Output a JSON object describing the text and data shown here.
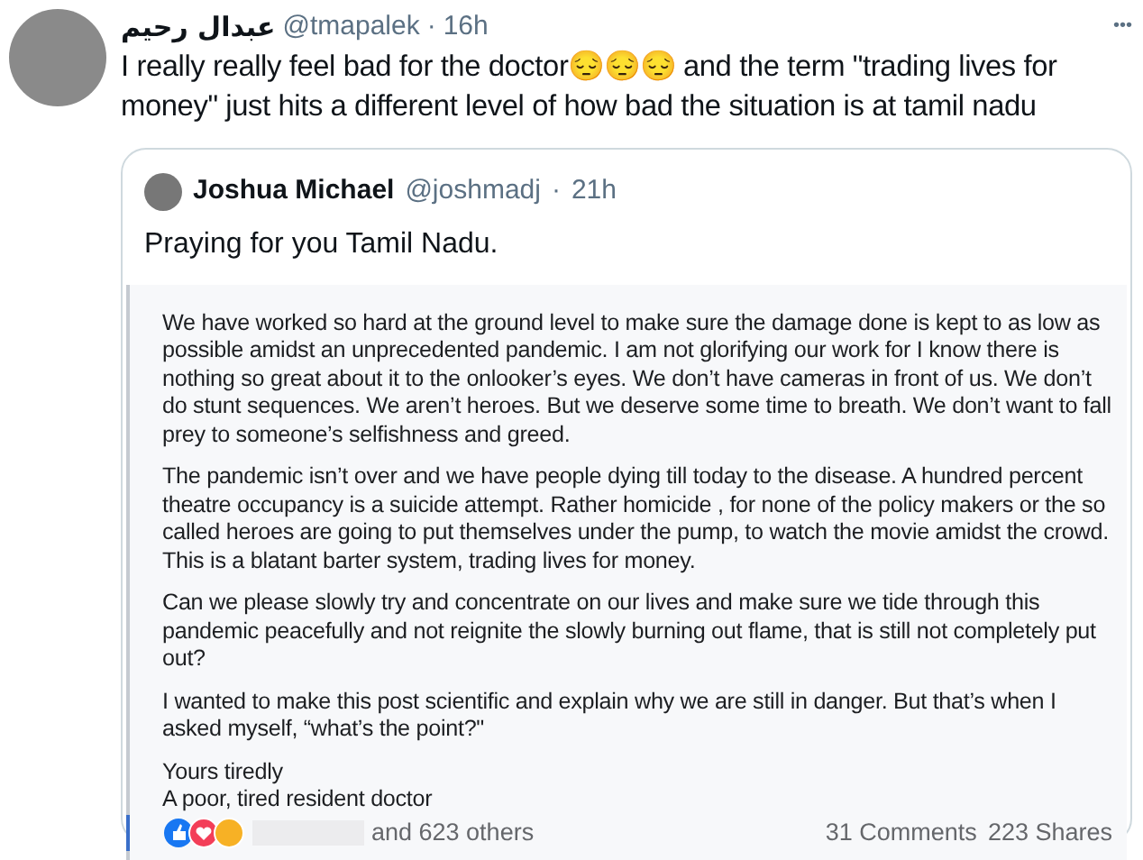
{
  "tweet": {
    "display_name": "عبدال رحيم",
    "handle": "@tmapalek",
    "separator": "·",
    "time": "16h",
    "more": "•••",
    "text": "I really really feel bad for the doctor😔😔😔 and the term \"trading lives for money\" just hits a different level of how bad the situation is at tamil nadu"
  },
  "quoted_tweet": {
    "display_name": "Joshua Michael",
    "handle": "@joshmadj",
    "separator": "·",
    "time": "21h",
    "text": "Praying for you Tamil Nadu."
  },
  "post_screenshot": {
    "paragraphs": [
      "We have worked so hard at the ground level to make sure the damage done is kept to as low as possible amidst an unprecedented pandemic. I am not glorifying our work for I know there is nothing so great about it to the onlooker’s eyes. We don’t have cameras in front of us. We don’t do stunt sequences. We aren’t heroes. But we deserve some time to breath. We don’t want to fall prey to someone’s selfishness and greed.",
      "The pandemic isn’t over and we have people dying till today to the disease. A hundred percent theatre occupancy is a suicide attempt. Rather homicide , for none of the policy makers or the so called heroes are going to put themselves under the pump, to watch the movie amidst the crowd. This is a blatant barter system, trading lives for money.",
      "Can we please slowly try and concentrate on our lives and make sure we tide through this pandemic peacefully and not reignite the slowly burning out flame, that is still not completely put out?",
      "I wanted to make this post scientific and explain why we are still in danger. But that’s when I asked myself, “what’s the point?\"",
      "Yours tiredly\nA poor, tired resident doctor"
    ],
    "reactions_text": "and 623 others",
    "comments": "31 Comments",
    "shares": "223 Shares"
  }
}
